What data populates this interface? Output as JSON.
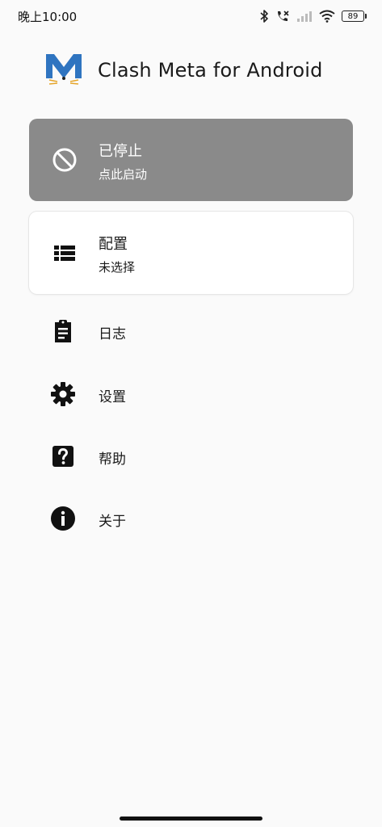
{
  "status_bar": {
    "time": "晚上10:00",
    "battery": "89"
  },
  "app": {
    "title": "Clash Meta for Android",
    "logo_icon": "cat-m-logo-icon"
  },
  "status_card": {
    "title": "已停止",
    "subtitle": "点此启动",
    "icon": "block-icon",
    "color": "#8a8a8a"
  },
  "profile_card": {
    "title": "配置",
    "subtitle": "未选择",
    "icon": "list-icon"
  },
  "menu": [
    {
      "label": "日志",
      "icon": "clipboard-icon"
    },
    {
      "label": "设置",
      "icon": "gear-icon"
    },
    {
      "label": "帮助",
      "icon": "help-icon"
    },
    {
      "label": "关于",
      "icon": "info-icon"
    }
  ]
}
